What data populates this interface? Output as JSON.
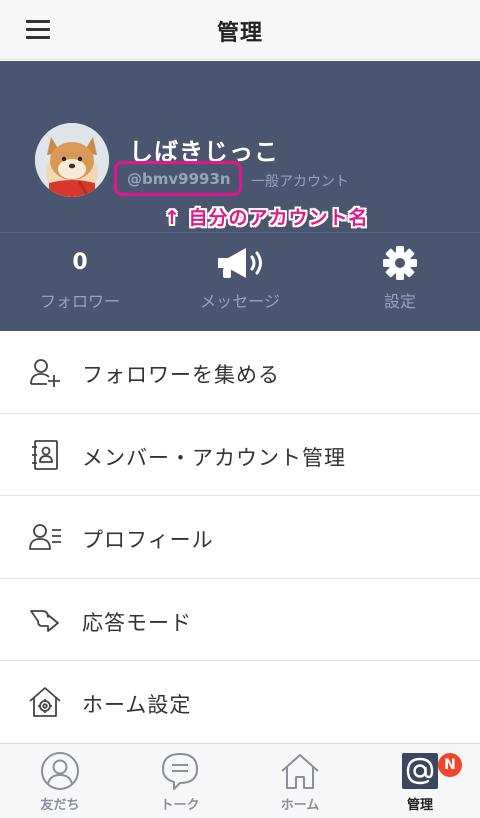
{
  "header": {
    "title": "管理",
    "menu_icon": "hamburger-icon"
  },
  "profile": {
    "name": "しばきじっこ",
    "account_id": "@bmv9993n",
    "account_type": "一般アカウント",
    "annotation": "↑ 自分のアカウント名",
    "annotation_color": "#e5158c",
    "background_color": "#4a5570"
  },
  "stats": [
    {
      "value": "0",
      "label": "フォロワー"
    },
    {
      "icon": "megaphone-icon",
      "label": "メッセージ"
    },
    {
      "icon": "gear-icon",
      "label": "設定"
    }
  ],
  "menu": {
    "items": [
      {
        "icon": "add-user-icon",
        "label": "フォロワーを集める"
      },
      {
        "icon": "address-book-icon",
        "label": "メンバー・アカウント管理"
      },
      {
        "icon": "profile-list-icon",
        "label": "プロフィール"
      },
      {
        "icon": "reply-arrow-icon",
        "label": "応答モード"
      },
      {
        "icon": "home-gear-icon",
        "label": "ホーム設定"
      }
    ]
  },
  "tabbar": {
    "tabs": [
      {
        "icon": "person-icon",
        "label": "友だち"
      },
      {
        "icon": "chat-icon",
        "label": "トーク"
      },
      {
        "icon": "home-icon",
        "label": "ホーム"
      },
      {
        "icon": "at-sign-icon",
        "label": "管理",
        "active": true,
        "badge": "N"
      }
    ]
  }
}
